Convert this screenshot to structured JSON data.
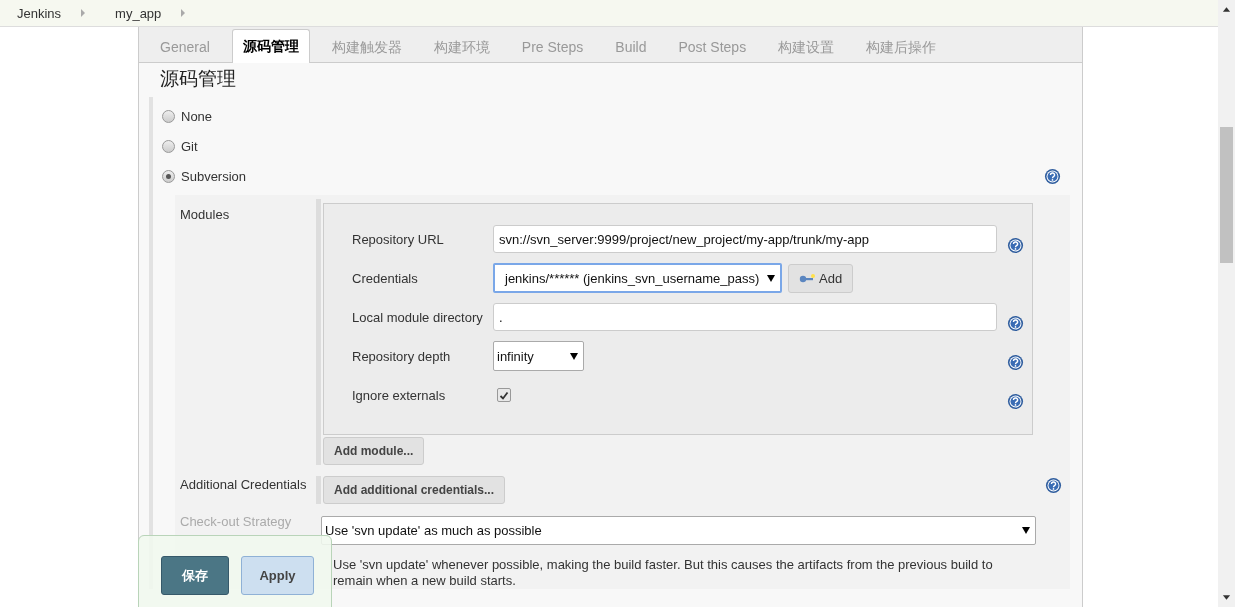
{
  "breadcrumbs": [
    {
      "label": "Jenkins"
    },
    {
      "label": "my_app"
    }
  ],
  "tabs": [
    {
      "label": "General",
      "selected": false
    },
    {
      "label": "源码管理",
      "selected": true
    },
    {
      "label": "构建触发器",
      "selected": false
    },
    {
      "label": "构建环境",
      "selected": false
    },
    {
      "label": "Pre Steps",
      "selected": false
    },
    {
      "label": "Build",
      "selected": false
    },
    {
      "label": "Post Steps",
      "selected": false
    },
    {
      "label": "构建设置",
      "selected": false
    },
    {
      "label": "构建后操作",
      "selected": false
    }
  ],
  "section_title": "源码管理",
  "scm_options": [
    {
      "label": "None",
      "selected": false,
      "help": false
    },
    {
      "label": "Git",
      "selected": false,
      "help": false
    },
    {
      "label": "Subversion",
      "selected": true,
      "help": true
    }
  ],
  "modules": {
    "label": "Modules",
    "fields": [
      {
        "kind": "text",
        "label": "Repository URL",
        "value": "svn://svn_server:9999/project/new_project/my-app/trunk/my-app",
        "help": true
      },
      {
        "kind": "select",
        "label": "Credentials",
        "value": "jenkins/****** (jenkins_svn_username_pass)",
        "focused": true,
        "button": "Add",
        "help": false
      },
      {
        "kind": "text",
        "label": "Local module directory",
        "value": ".",
        "help": true
      },
      {
        "kind": "select",
        "label": "Repository depth",
        "value": "infinity",
        "focused": false,
        "help": true
      },
      {
        "kind": "checkbox",
        "label": "Ignore externals",
        "checked": true,
        "help": true
      }
    ],
    "add_button": "Add module..."
  },
  "additional_credentials": {
    "label": "Additional Credentials",
    "button": "Add additional credentials...",
    "help": true
  },
  "checkout_strategy": {
    "label": "Check-out Strategy",
    "value": "Use 'svn update' as much as possible",
    "description": "Use 'svn update' whenever possible, making the build faster. But this causes the artifacts from the previous build to remain when a new build starts."
  },
  "save_bar": {
    "save": "保存",
    "apply": "Apply"
  }
}
